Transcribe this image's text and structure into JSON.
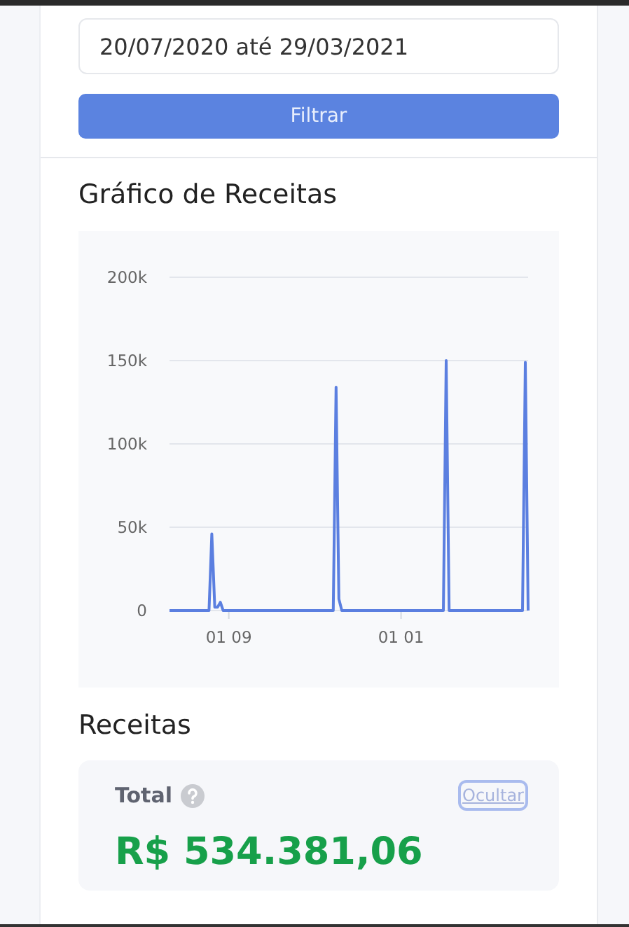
{
  "date_range": {
    "value": "20/07/2020 até 29/03/2021"
  },
  "filter_button": {
    "label": "Filtrar"
  },
  "revenue_chart": {
    "title": "Gráfico de Receitas",
    "chart_data": {
      "type": "line",
      "categories": [
        null,
        null,
        null,
        null,
        null,
        null,
        null,
        null,
        null,
        null,
        null,
        null,
        null,
        null,
        null,
        null,
        null,
        null,
        null,
        null,
        null,
        "01 09",
        null,
        null,
        null,
        null,
        null,
        null,
        null,
        null,
        null,
        null,
        null,
        null,
        null,
        null,
        null,
        null,
        null,
        null,
        null,
        null,
        null,
        null,
        null,
        null,
        null,
        null,
        null,
        null,
        null,
        null,
        null,
        null,
        null,
        null,
        null,
        null,
        null,
        null,
        null,
        null,
        null,
        null,
        null,
        null,
        null,
        null,
        null,
        null,
        null,
        null,
        null,
        null,
        null,
        null,
        null,
        null,
        null,
        null,
        null,
        null,
        "01 01",
        null,
        null,
        null,
        null,
        null,
        null,
        null,
        null,
        null,
        null,
        null,
        null,
        null,
        null,
        null,
        null,
        null,
        null,
        null,
        null,
        null,
        null,
        null,
        null,
        null,
        null,
        null,
        null,
        null,
        null,
        null,
        null,
        null,
        null,
        null,
        null,
        null,
        null,
        null,
        null,
        null,
        null,
        null,
        null,
        null
      ],
      "series": [
        {
          "color": "#5b7fe0",
          "values": [
            0,
            0,
            0,
            0,
            0,
            0,
            0,
            0,
            0,
            0,
            0,
            0,
            0,
            0,
            0,
            46000,
            2000,
            2000,
            5000,
            0,
            0,
            0,
            0,
            0,
            0,
            0,
            0,
            0,
            0,
            0,
            0,
            0,
            0,
            0,
            0,
            0,
            0,
            0,
            0,
            0,
            0,
            0,
            0,
            0,
            0,
            0,
            0,
            0,
            0,
            0,
            0,
            0,
            0,
            0,
            0,
            0,
            0,
            0,
            0,
            134000,
            7000,
            0,
            0,
            0,
            0,
            0,
            0,
            0,
            0,
            0,
            0,
            0,
            0,
            0,
            0,
            0,
            0,
            0,
            0,
            0,
            0,
            0,
            0,
            0,
            0,
            0,
            0,
            0,
            0,
            0,
            0,
            0,
            0,
            0,
            0,
            0,
            0,
            0,
            150000,
            0,
            0,
            0,
            0,
            0,
            0,
            0,
            0,
            0,
            0,
            0,
            0,
            0,
            0,
            0,
            0,
            0,
            0,
            0,
            0,
            0,
            0,
            0,
            0,
            0,
            0,
            0,
            149000,
            0
          ]
        }
      ],
      "ylim": [
        0,
        200000
      ],
      "grid": true,
      "yticks": [
        {
          "value": 0,
          "label": "0"
        },
        {
          "value": 50000,
          "label": "50k"
        },
        {
          "value": 100000,
          "label": "100k"
        },
        {
          "value": 150000,
          "label": "150k"
        },
        {
          "value": 200000,
          "label": "200k"
        }
      ]
    }
  },
  "revenue_section": {
    "title": "Receitas",
    "total_label": "Total",
    "hide_link": "Ocultar",
    "total_value": "R$ 534.381,06"
  }
}
